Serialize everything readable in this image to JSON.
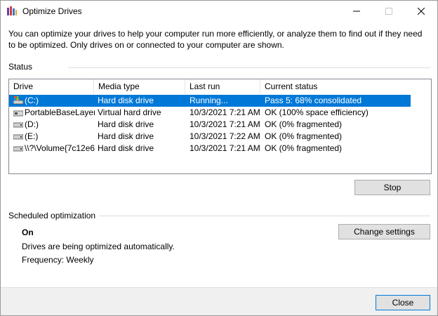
{
  "window": {
    "title": "Optimize Drives",
    "app_icon": "defrag-icon"
  },
  "intro_text": "You can optimize your drives to help your computer run more efficiently, or analyze them to find out if they need to be optimized. Only drives on or connected to your computer are shown.",
  "status": {
    "label": "Status",
    "columns": [
      "Drive",
      "Media type",
      "Last run",
      "Current status"
    ],
    "drives": [
      {
        "drive": "(C:)",
        "media_type": "Hard disk drive",
        "last_run": "Running...",
        "current_status": "Pass 5: 68% consolidated",
        "icon": "system-drive-icon",
        "selected": true
      },
      {
        "drive": "PortableBaseLayer ...",
        "media_type": "Virtual hard drive",
        "last_run": "10/3/2021 7:21 AM",
        "current_status": "OK (100% space efficiency)",
        "icon": "virtual-drive-icon",
        "selected": false
      },
      {
        "drive": "(D:)",
        "media_type": "Hard disk drive",
        "last_run": "10/3/2021 7:21 AM",
        "current_status": "OK (0% fragmented)",
        "icon": "hard-drive-icon",
        "selected": false
      },
      {
        "drive": "(E:)",
        "media_type": "Hard disk drive",
        "last_run": "10/3/2021 7:22 AM",
        "current_status": "OK (0% fragmented)",
        "icon": "hard-drive-icon",
        "selected": false
      },
      {
        "drive": "\\\\?\\Volume{7c12e6...",
        "media_type": "Hard disk drive",
        "last_run": "10/3/2021 7:21 AM",
        "current_status": "OK (0% fragmented)",
        "icon": "hard-drive-icon",
        "selected": false
      }
    ],
    "stop_button": "Stop"
  },
  "scheduled": {
    "label": "Scheduled optimization",
    "state": "On",
    "description": "Drives are being optimized automatically.",
    "frequency": "Frequency: Weekly",
    "change_button": "Change settings"
  },
  "footer": {
    "close_button": "Close"
  },
  "colors": {
    "selection": "#0078d7",
    "window_bg": "#f0f0f0"
  }
}
